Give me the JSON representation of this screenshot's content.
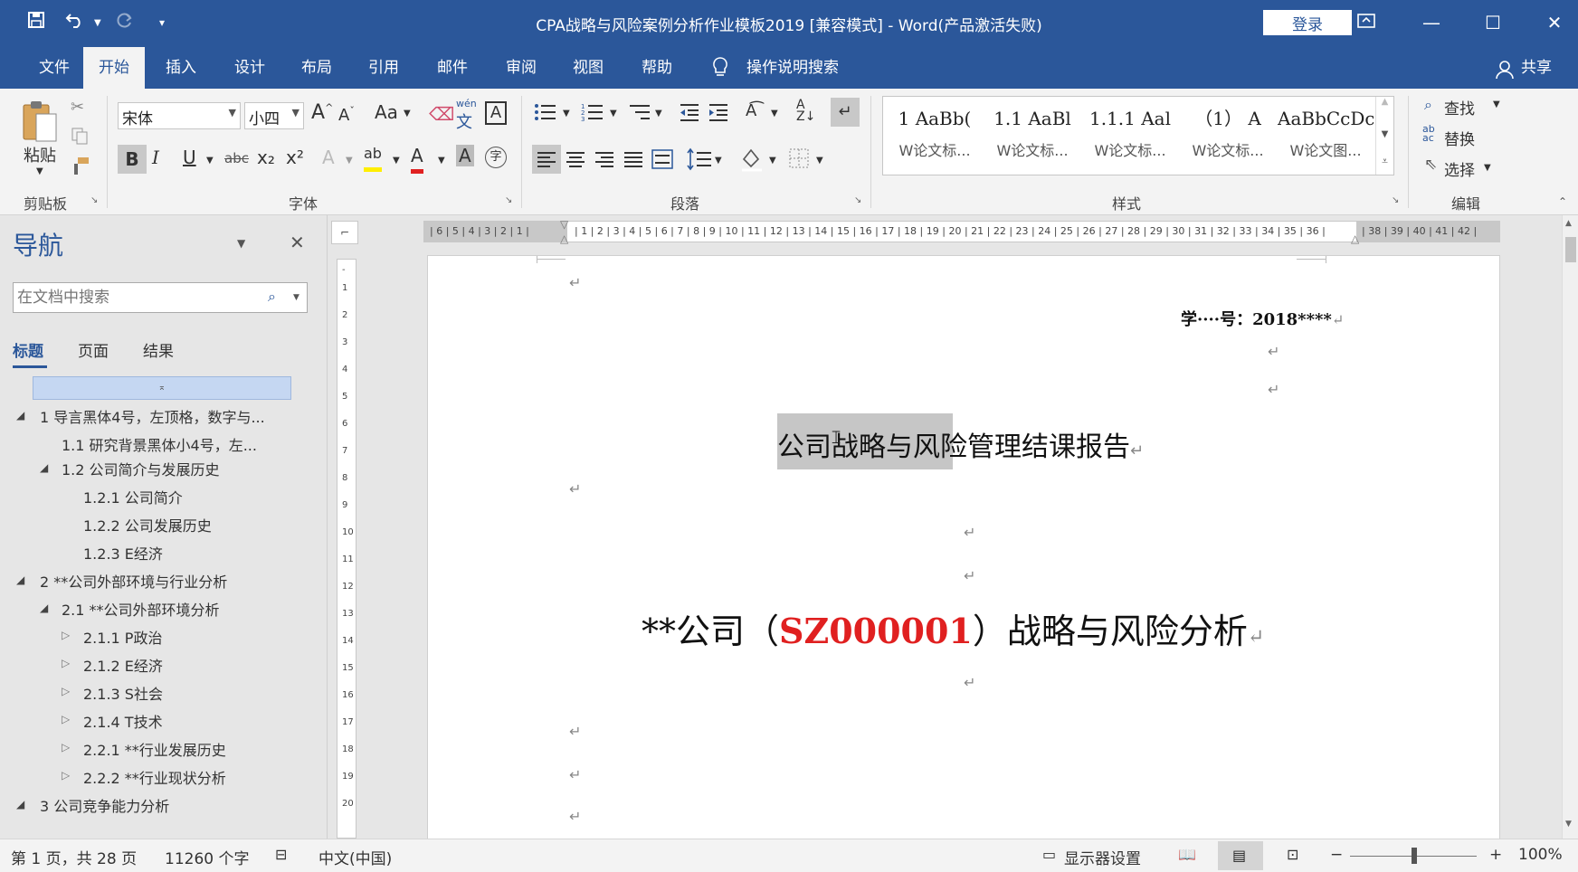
{
  "window": {
    "title": "CPA战略与风险案例分析作业模板2019 [兼容模式]  -  Word(产品激活失败)",
    "login_label": "登录",
    "share_label": "共享"
  },
  "menu_tabs": [
    "文件",
    "开始",
    "插入",
    "设计",
    "布局",
    "引用",
    "邮件",
    "审阅",
    "视图",
    "帮助"
  ],
  "active_tab": "开始",
  "tell_me": "操作说明搜索",
  "ribbon": {
    "clipboard": {
      "paste_label": "粘贴",
      "group_label": "剪贴板"
    },
    "font": {
      "font_name": "宋体",
      "font_size": "小四",
      "group_label": "字体",
      "change_case": "Aa",
      "phonetic": "wén",
      "bold": "B",
      "italic": "I",
      "underline": "U",
      "strike": "abc",
      "subscript": "x₂",
      "superscript": "x²",
      "effects": "A",
      "highlight": "ab",
      "color": "A",
      "shading": "A",
      "enclose": "字"
    },
    "paragraph": {
      "group_label": "段落"
    },
    "styles": {
      "group_label": "样式",
      "items": [
        {
          "sample": "1  AaBb(",
          "name": "W论文标..."
        },
        {
          "sample": "1.1  AaBl",
          "name": "W论文标..."
        },
        {
          "sample": "1.1.1  Aal",
          "name": "W论文标..."
        },
        {
          "sample": "（1）  A",
          "name": "W论文标..."
        },
        {
          "sample": "AaBbCcDc",
          "name": "W论文图..."
        }
      ]
    },
    "editing": {
      "group_label": "编辑",
      "find": "查找",
      "replace": "替换",
      "select": "选择"
    }
  },
  "nav": {
    "title": "导航",
    "search_placeholder": "在文档中搜索",
    "tabs": [
      "标题",
      "页面",
      "结果"
    ],
    "active_tab": "标题",
    "tree": [
      {
        "label": "1 导言黑体4号，左顶格，数字与...",
        "level": 0,
        "marker": "expanded"
      },
      {
        "label": "1.1 研究背景黑体小4号，左...",
        "level": 1,
        "marker": "none"
      },
      {
        "label": "1.2 公司简介与发展历史",
        "level": 1,
        "marker": "expanded"
      },
      {
        "label": "1.2.1 公司简介",
        "level": 2,
        "marker": "none"
      },
      {
        "label": "1.2.2 公司发展历史",
        "level": 2,
        "marker": "none"
      },
      {
        "label": "1.2.3 E经济",
        "level": 2,
        "marker": "none"
      },
      {
        "label": "2 **公司外部环境与行业分析",
        "level": 0,
        "marker": "expanded"
      },
      {
        "label": "2.1 **公司外部环境分析",
        "level": 1,
        "marker": "expanded"
      },
      {
        "label": "2.1.1 P政治",
        "level": 2,
        "marker": "collapsed"
      },
      {
        "label": "2.1.2 E经济",
        "level": 2,
        "marker": "collapsed"
      },
      {
        "label": "2.1.3 S社会",
        "level": 2,
        "marker": "collapsed"
      },
      {
        "label": "2.1.4 T技术",
        "level": 2,
        "marker": "collapsed"
      },
      {
        "label": "2.2.1 **行业发展历史",
        "level": 2,
        "marker": "collapsed"
      },
      {
        "label": "2.2.2 **行业现状分析",
        "level": 2,
        "marker": "collapsed"
      },
      {
        "label": "3 公司竞争能力分析",
        "level": 0,
        "marker": "expanded"
      }
    ]
  },
  "document": {
    "student_id_label": "学····号：",
    "student_id_value": "2018****",
    "report_title": "公司战略与风险管理结课报告",
    "main_title_prefix": "**公司（",
    "main_title_code": "SZ000001",
    "main_title_suffix": "）战略与风险分析",
    "paragraph_mark": "↵"
  },
  "status": {
    "page": "第 1 页，共 28 页",
    "words": "11260 个字",
    "language": "中文(中国)",
    "display_settings": "显示器设置",
    "zoom": "100%"
  },
  "colors": {
    "brand": "#2b579a",
    "code_red": "#e02020"
  }
}
